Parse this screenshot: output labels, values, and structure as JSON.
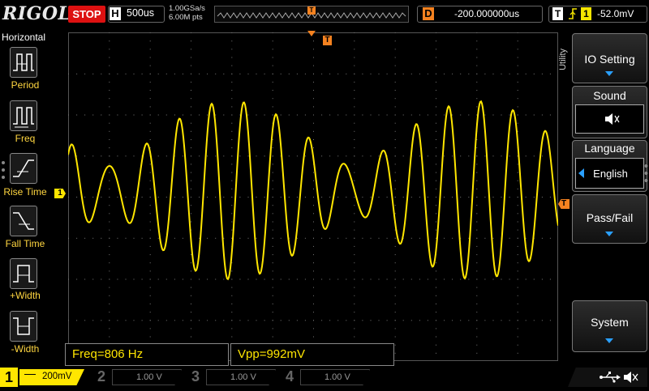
{
  "topbar": {
    "logo": "RIGOL",
    "run_state": "STOP",
    "horizontal_label": "H",
    "timebase": "500us",
    "sample_rate": "1.00GSa/s",
    "memory_depth": "6.00M pts",
    "trigger_marker": "T",
    "delay_label": "D",
    "delay_value": "-200.000000us",
    "trigger_label": "T",
    "trigger_source": "1",
    "trigger_level": "-52.0mV"
  },
  "left_menu": {
    "title": "Horizontal",
    "items": [
      {
        "label": "Period",
        "icon": "period-icon"
      },
      {
        "label": "Freq",
        "icon": "freq-icon"
      },
      {
        "label": "Rise Time",
        "icon": "rise-time-icon"
      },
      {
        "label": "Fall Time",
        "icon": "fall-time-icon"
      },
      {
        "label": "+Width",
        "icon": "pos-width-icon"
      },
      {
        "label": "-Width",
        "icon": "neg-width-icon"
      }
    ]
  },
  "right_menu": {
    "vertical_title": "Utility",
    "items": [
      {
        "label": "IO Setting"
      },
      {
        "label": "Sound",
        "value": "speaker-muted-icon"
      },
      {
        "label": "Language",
        "value": "English"
      },
      {
        "label": "Pass/Fail"
      },
      {
        "label": "System"
      }
    ]
  },
  "markers": {
    "ch1_ground": "1",
    "trigger_level": "T"
  },
  "measurements": [
    {
      "text": "Freq=806 Hz"
    },
    {
      "text": "Vpp=992mV"
    }
  ],
  "channels": [
    {
      "num": "1",
      "scale": "200mV",
      "color": "#ffe600",
      "active": true
    },
    {
      "num": "2",
      "scale": "1.00 V",
      "color": "#00c0ff",
      "active": false
    },
    {
      "num": "3",
      "scale": "1.00 V",
      "color": "#e040e0",
      "active": false
    },
    {
      "num": "4",
      "scale": "1.00 V",
      "color": "#2070ff",
      "active": false
    }
  ],
  "colors": {
    "trace": "#ffe600",
    "accent": "#f58220",
    "stop": "#dd1111"
  }
}
